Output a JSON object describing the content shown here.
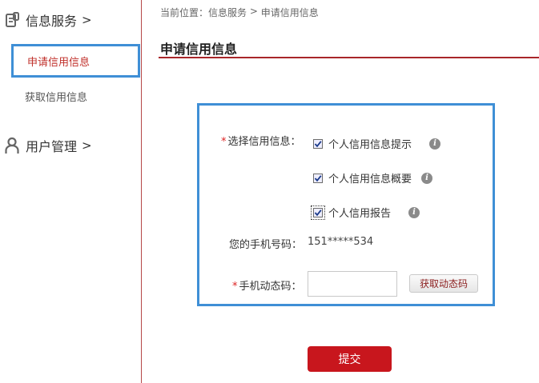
{
  "sidebar": {
    "info_group": {
      "icon": "document-icon",
      "label": "信息服务",
      "arrow": ">"
    },
    "items": [
      {
        "label": "申请信用信息",
        "active": true
      },
      {
        "label": "获取信用信息",
        "active": false
      }
    ],
    "user_group": {
      "icon": "user-icon",
      "label": "用户管理",
      "arrow": ">"
    }
  },
  "breadcrumb": {
    "prefix": "当前位置：",
    "level1": "信息服务",
    "separator": " > ",
    "level2": "申请信用信息"
  },
  "page": {
    "title": "申请信用信息"
  },
  "form": {
    "required_mark": "*",
    "select_label": "选择信用信息：",
    "options": [
      {
        "label": "个人信用信息提示",
        "checked": true
      },
      {
        "label": "个人信用信息概要",
        "checked": true
      },
      {
        "label": "个人信用报告",
        "checked": true
      }
    ],
    "info_glyph": "i",
    "phone_label": "您的手机号码：",
    "phone_value": "151*****534",
    "code_label": "手机动态码：",
    "code_value": "",
    "get_code_label": "获取动态码",
    "submit_label": "提交"
  },
  "colors": {
    "accent_red": "#c8161d",
    "highlight_blue": "#3f8fd6",
    "rule_red": "#a8262a"
  }
}
